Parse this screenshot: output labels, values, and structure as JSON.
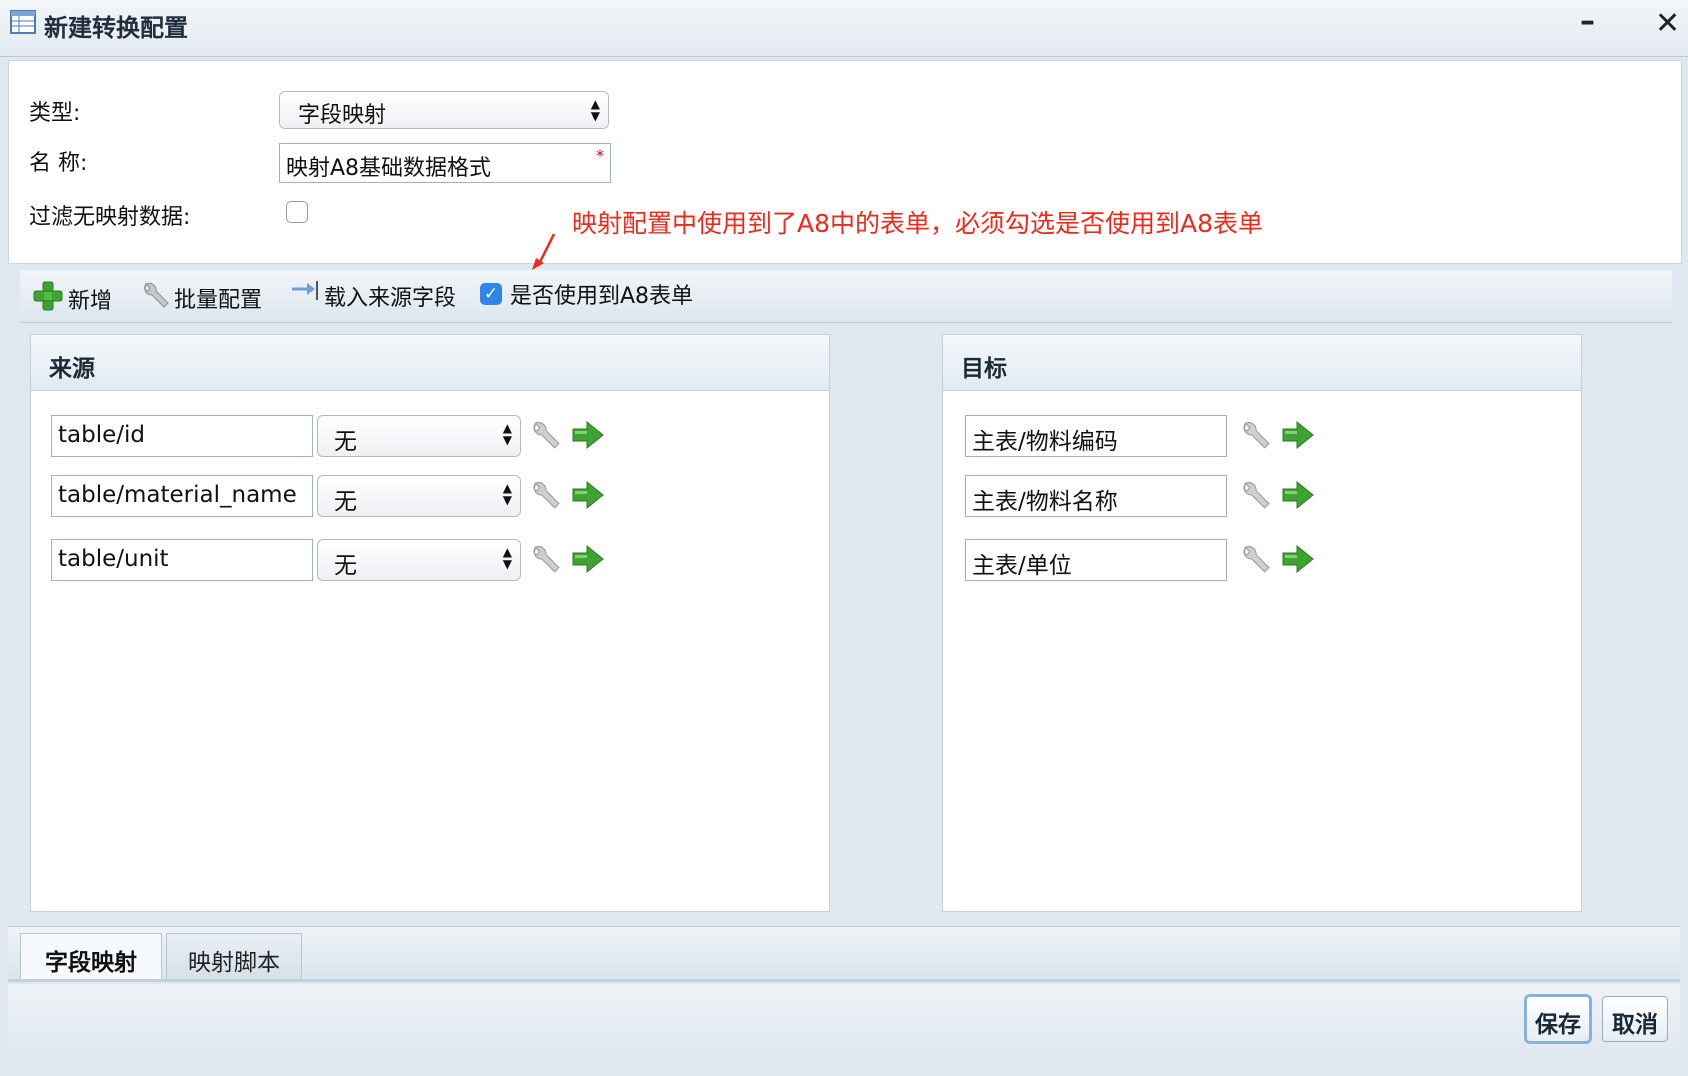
{
  "window": {
    "title": "新建转换配置",
    "minimize_glyph": "–",
    "close_glyph": "✕"
  },
  "form": {
    "type_label": "类型:",
    "type_value": "字段映射",
    "name_label": "名 称:",
    "name_value": "映射A8基础数据格式",
    "required_mark": "*",
    "filter_label": "过滤无映射数据:",
    "filter_checked": false
  },
  "annotation": {
    "text": "映射配置中使用到了A8中的表单，必须勾选是否使用到A8表单",
    "color": "#ee2a1c"
  },
  "toolbar": {
    "add_label": "新增",
    "batch_label": "批量配置",
    "load_label": "载入来源字段",
    "use_a8_label": "是否使用到A8表单",
    "use_a8_checked": true
  },
  "source_panel": {
    "title": "来源",
    "rows": [
      {
        "field": "table/id",
        "option": "无"
      },
      {
        "field": "table/material_name",
        "option": "无"
      },
      {
        "field": "table/unit",
        "option": "无"
      }
    ]
  },
  "target_panel": {
    "title": "目标",
    "rows": [
      {
        "field": "主表/物料编码"
      },
      {
        "field": "主表/物料名称"
      },
      {
        "field": "主表/单位"
      }
    ]
  },
  "tabs": [
    {
      "label": "字段映射",
      "active": true
    },
    {
      "label": "映射脚本",
      "active": false
    }
  ],
  "footer": {
    "save_label": "保存",
    "cancel_label": "取消"
  },
  "icons": {
    "window": "table-icon",
    "add": "green-plus-icon",
    "batch": "wrench-icon",
    "load": "import-arrow-icon",
    "row_config": "wrench-icon",
    "row_go": "green-arrow-icon"
  }
}
